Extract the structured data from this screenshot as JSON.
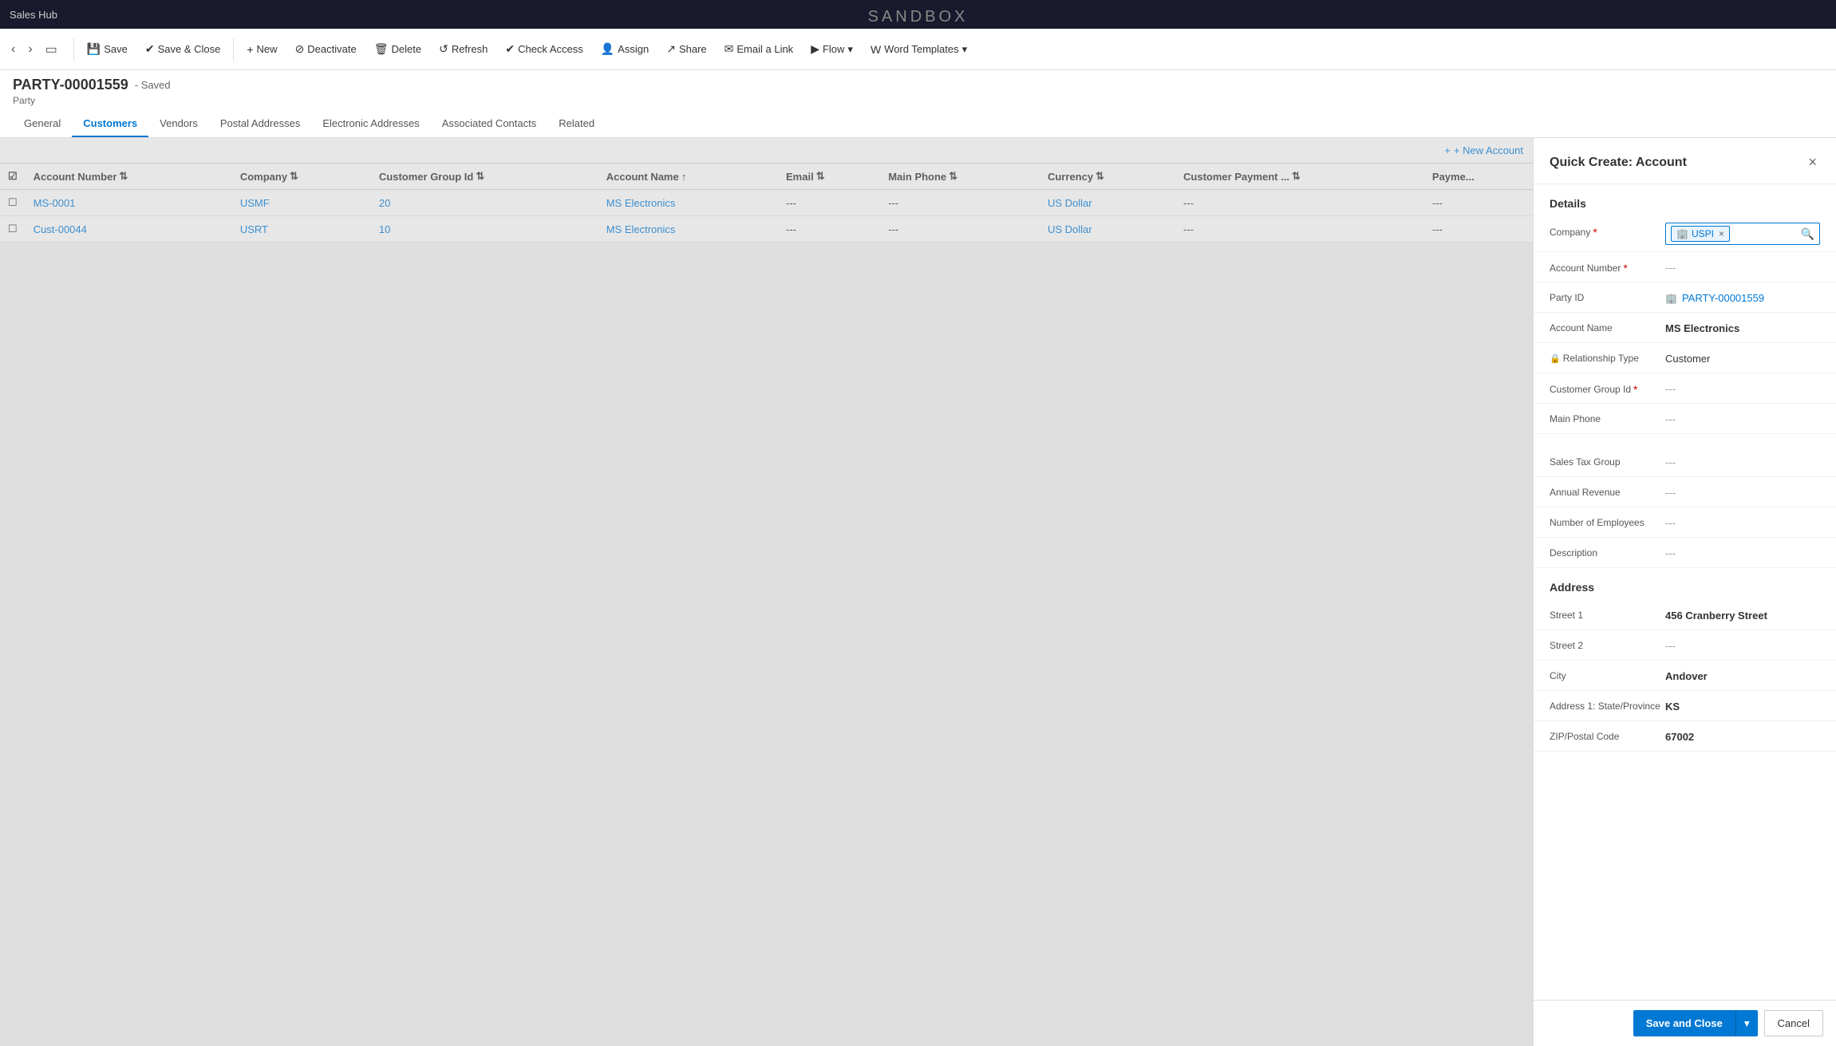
{
  "app": {
    "name": "Sales Hub",
    "sandbox_label": "SANDBOX"
  },
  "toolbar": {
    "save_label": "Save",
    "save_close_label": "Save & Close",
    "new_label": "New",
    "deactivate_label": "Deactivate",
    "delete_label": "Delete",
    "refresh_label": "Refresh",
    "check_access_label": "Check Access",
    "assign_label": "Assign",
    "share_label": "Share",
    "email_link_label": "Email a Link",
    "flow_label": "Flow",
    "word_templates_label": "Word Templates"
  },
  "record": {
    "id": "PARTY-00001559",
    "status": "Saved",
    "type": "Party"
  },
  "tabs": [
    {
      "id": "general",
      "label": "General",
      "active": false
    },
    {
      "id": "customers",
      "label": "Customers",
      "active": true
    },
    {
      "id": "vendors",
      "label": "Vendors",
      "active": false
    },
    {
      "id": "postal_addresses",
      "label": "Postal Addresses",
      "active": false
    },
    {
      "id": "electronic_addresses",
      "label": "Electronic Addresses",
      "active": false
    },
    {
      "id": "associated_contacts",
      "label": "Associated Contacts",
      "active": false
    },
    {
      "id": "related",
      "label": "Related",
      "active": false
    }
  ],
  "customers_table": {
    "new_account_label": "+ New Account",
    "columns": [
      {
        "id": "check",
        "label": ""
      },
      {
        "id": "account_number",
        "label": "Account Number"
      },
      {
        "id": "company",
        "label": "Company"
      },
      {
        "id": "customer_group_id",
        "label": "Customer Group Id"
      },
      {
        "id": "account_name",
        "label": "Account Name"
      },
      {
        "id": "email",
        "label": "Email"
      },
      {
        "id": "main_phone",
        "label": "Main Phone"
      },
      {
        "id": "currency",
        "label": "Currency"
      },
      {
        "id": "customer_payment",
        "label": "Customer Payment ..."
      },
      {
        "id": "payment",
        "label": "Payme..."
      }
    ],
    "rows": [
      {
        "check": "",
        "account_number": "MS-0001",
        "company": "USMF",
        "customer_group_id": "20",
        "account_name": "MS Electronics",
        "email": "---",
        "main_phone": "---",
        "currency": "US Dollar",
        "customer_payment": "---",
        "payment": "---"
      },
      {
        "check": "",
        "account_number": "Cust-00044",
        "company": "USRT",
        "customer_group_id": "10",
        "account_name": "MS Electronics",
        "email": "---",
        "main_phone": "---",
        "currency": "US Dollar",
        "customer_payment": "---",
        "payment": "---"
      }
    ]
  },
  "quick_create": {
    "title": "Quick Create: Account",
    "sections": {
      "details_label": "Details",
      "address_label": "Address"
    },
    "fields": {
      "company": {
        "label": "Company",
        "required": true,
        "value": "USPI",
        "type": "chip"
      },
      "account_number": {
        "label": "Account Number",
        "required": true,
        "value": "---"
      },
      "party_id": {
        "label": "Party ID",
        "value": "PARTY-00001559",
        "type": "link"
      },
      "account_name": {
        "label": "Account Name",
        "value": "MS Electronics",
        "type": "bold"
      },
      "relationship_type": {
        "label": "Relationship Type",
        "has_lock": true,
        "value": "Customer"
      },
      "customer_group_id": {
        "label": "Customer Group Id",
        "required": true,
        "value": "---"
      },
      "main_phone": {
        "label": "Main Phone",
        "value": "---"
      },
      "sales_tax_group": {
        "label": "Sales Tax Group",
        "value": "---"
      },
      "annual_revenue": {
        "label": "Annual Revenue",
        "value": "---"
      },
      "number_of_employees": {
        "label": "Number of Employees",
        "value": "---"
      },
      "description": {
        "label": "Description",
        "value": "---"
      },
      "street_1": {
        "label": "Street 1",
        "value": "456 Cranberry Street",
        "type": "bold"
      },
      "street_2": {
        "label": "Street 2",
        "value": "---"
      },
      "city": {
        "label": "City",
        "value": "Andover",
        "type": "bold"
      },
      "state_province": {
        "label": "Address 1: State/Province",
        "value": "KS",
        "type": "bold"
      },
      "zip_code": {
        "label": "ZIP/Postal Code",
        "value": "67002",
        "type": "bold"
      }
    },
    "footer": {
      "save_close_label": "Save and Close",
      "cancel_label": "Cancel"
    }
  },
  "icons": {
    "save": "💾",
    "save_close": "✔",
    "new": "+",
    "deactivate": "⊘",
    "delete": "🗑",
    "refresh": "↺",
    "check_access": "✔",
    "assign": "👤",
    "share": "↗",
    "email": "✉",
    "flow": "▶",
    "word": "W",
    "back": "‹",
    "forward": "›",
    "pop_out": "⬡",
    "close": "×",
    "sort_asc": "↑",
    "sort_desc": "↓",
    "sort_both": "⇅",
    "party": "🏢",
    "search": "🔍",
    "dropdown": "▾",
    "chevron_down": "▾"
  }
}
